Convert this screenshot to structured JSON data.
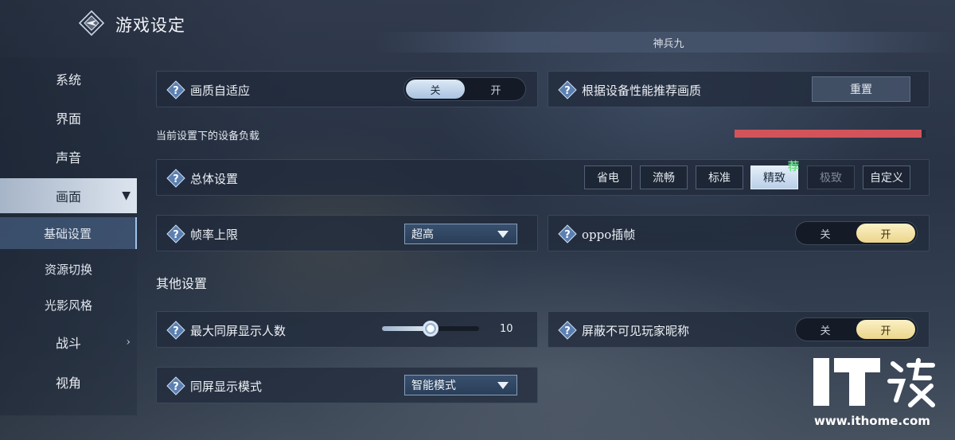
{
  "header": {
    "title": "游戏设定",
    "banner_text": "神兵九"
  },
  "sidebar": {
    "items": [
      {
        "label": "系统"
      },
      {
        "label": "界面"
      },
      {
        "label": "声音"
      },
      {
        "label": "画面",
        "expanded": true
      },
      {
        "label": "战斗"
      },
      {
        "label": "视角"
      }
    ],
    "subitems": [
      {
        "label": "基础设置",
        "selected": true
      },
      {
        "label": "资源切换"
      },
      {
        "label": "光影风格"
      }
    ]
  },
  "settings": {
    "adaptive_quality": {
      "label": "画质自适应",
      "off": "关",
      "on": "开",
      "value": "关"
    },
    "recommend": {
      "label": "根据设备性能推荐画质",
      "button": "重置"
    },
    "device_load": {
      "label": "当前设置下的设备负载",
      "level": 0.98,
      "color": "#d2545a"
    },
    "overall": {
      "label": "总体设置",
      "presets": [
        "省电",
        "流畅",
        "标准",
        "精致",
        "极致",
        "自定义"
      ],
      "selected": "精致",
      "disabled": [
        "极致"
      ],
      "recommended_badge": "荐"
    },
    "frame_limit": {
      "label": "帧率上限",
      "value": "超高"
    },
    "oppo_interp": {
      "label": "oppo插帧",
      "off": "关",
      "on": "开",
      "value": "开"
    },
    "other_title": "其他设置",
    "max_players": {
      "label": "最大同屏显示人数",
      "value": "10",
      "level": 0.5
    },
    "hide_names": {
      "label": "屏蔽不可见玩家昵称",
      "off": "关",
      "on": "开",
      "value": "开"
    },
    "display_mode": {
      "label": "同屏显示模式",
      "value": "智能模式"
    }
  },
  "watermark": {
    "logo": "IT之家",
    "url": "www.ithome.com"
  }
}
